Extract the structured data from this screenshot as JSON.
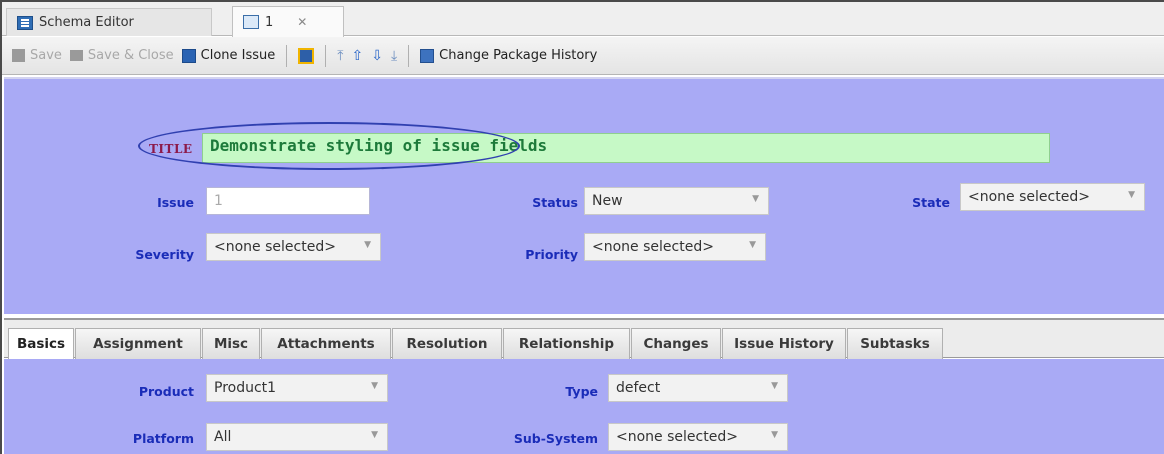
{
  "editor_tabs": [
    {
      "label": "Schema Editor",
      "icon": "schema-icon"
    },
    {
      "label": "1",
      "icon": "issue-doc-icon",
      "close": "✕"
    }
  ],
  "toolbar": {
    "save": "Save",
    "save_close": "Save & Close",
    "clone": "Clone Issue",
    "change_history": "Change Package History"
  },
  "form": {
    "title_label": "TITLE",
    "title_value": "Demonstrate styling of issue fields",
    "issue_label": "Issue",
    "issue_value": "1",
    "status_label": "Status",
    "status_value": "New",
    "state_label": "State",
    "state_value": "<none selected>",
    "severity_label": "Severity",
    "severity_value": "<none selected>",
    "priority_label": "Priority",
    "priority_value": "<none selected>"
  },
  "bottom_tabs": [
    "Basics",
    "Assignment",
    "Misc",
    "Attachments",
    "Resolution",
    "Relationship",
    "Changes",
    "Issue History",
    "Subtasks"
  ],
  "basics": {
    "product_label": "Product",
    "product_value": "Product1",
    "type_label": "Type",
    "type_value": "defect",
    "platform_label": "Platform",
    "platform_value": "All",
    "subsystem_label": "Sub-System",
    "subsystem_value": "<none selected>"
  },
  "colors": {
    "panel": "#a9aaf5",
    "label": "#1a2cb8",
    "title_bg": "#c6f9c6",
    "title_text": "#1d7a3a",
    "highlight": "#3040b0"
  }
}
